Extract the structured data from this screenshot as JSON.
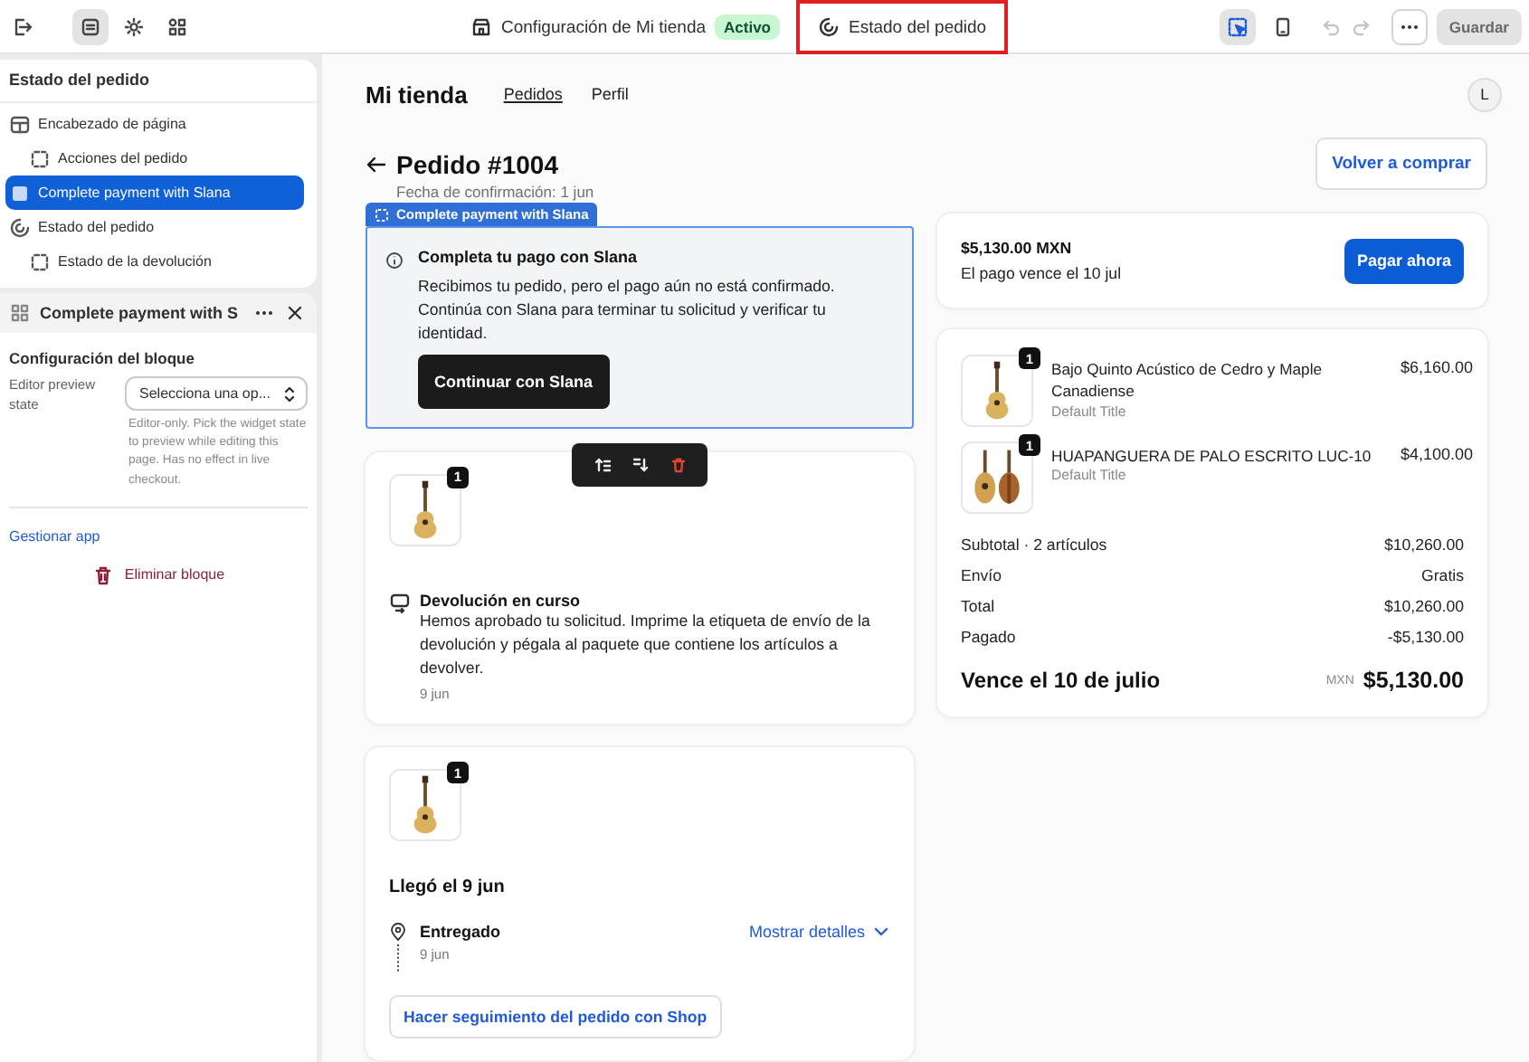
{
  "topbar": {
    "tools": [
      {
        "kind": "sections",
        "selected": true
      },
      {
        "kind": "settings",
        "selected": false
      },
      {
        "kind": "apps",
        "selected": false
      }
    ],
    "store_title": "Configuración de Mi tienda",
    "status_badge": "Activo",
    "page_selector": {
      "label": "Estado del pedido",
      "highlighted": true
    },
    "view_tools": [
      {
        "kind": "inspector",
        "selected": true
      },
      {
        "kind": "mobile",
        "selected": false
      }
    ],
    "history_disabled": true,
    "save_button": {
      "label": "Guardar",
      "disabled": true
    }
  },
  "sidebar": {
    "title": "Estado del pedido",
    "items": [
      {
        "label": "Encabezado de página",
        "kind": "section",
        "selected": false,
        "children": [
          {
            "label": "Acciones del pedido",
            "kind": "block",
            "selected": false
          }
        ]
      },
      {
        "label": "Complete payment with Slana",
        "kind": "app",
        "selected": true
      },
      {
        "label": "Estado del pedido",
        "kind": "status",
        "selected": false,
        "children": [
          {
            "label": "Estado de la devolución",
            "kind": "block",
            "selected": false
          }
        ]
      }
    ]
  },
  "block_panel": {
    "title": "Complete payment with S",
    "section_title": "Configuración del bloque",
    "field": {
      "label": "Editor preview state",
      "value": "Selecciona una op...",
      "help": "Editor-only. Pick the widget state to preview while editing this page. Has no effect in live checkout."
    },
    "manage_link": "Gestionar app",
    "delete_button": "Eliminar bloque"
  },
  "preview": {
    "store_name": "Mi tienda",
    "nav": [
      {
        "label": "Pedidos",
        "selected": true
      },
      {
        "label": "Perfil",
        "selected": false
      }
    ],
    "avatar": "L",
    "order_title": "Pedido #1004",
    "confirmation": "Fecha de confirmación: 1 jun",
    "reorder_button": "Volver a comprar",
    "block_tag": "Complete payment with Slana",
    "payment_block": {
      "title": "Completa tu pago con Slana",
      "body": "Recibimos tu pedido, pero el pago aún no está confirmado. Continúa con Slana para terminar tu solicitud y verificar tu identidad.",
      "button": "Continuar con Slana"
    },
    "return_card": {
      "quantity": "1",
      "title": "Devolución en curso",
      "body": "Hemos aprobado tu solicitud. Imprime la etiqueta de envío de la devolución y pégala al paquete que contiene los artículos a devolver.",
      "date": "9 jun"
    },
    "delivery_card": {
      "quantity": "1",
      "title": "Llegó el 9 jun",
      "status": "Entregado",
      "date": "9 jun",
      "details_link": "Mostrar detalles",
      "track_button": "Hacer seguimiento del pedido con Shop"
    },
    "payment_due": {
      "amount": "$5,130.00 MXN",
      "due": "El pago vence el 10 jul",
      "button": "Pagar ahora"
    },
    "summary": {
      "items": [
        {
          "name": "Bajo Quinto Acústico de Cedro y Maple Canadiense",
          "variant": "Default Title",
          "price": "$6,160.00",
          "quantity": "1",
          "kind": "single"
        },
        {
          "name": "HUAPANGUERA DE PALO ESCRITO LUC-10",
          "variant": "Default Title",
          "price": "$4,100.00",
          "quantity": "1",
          "kind": "double"
        }
      ],
      "rows": [
        {
          "label": "Subtotal · 2 artículos",
          "value": "$10,260.00"
        },
        {
          "label": "Envío",
          "value": "Gratis"
        },
        {
          "label": "Total",
          "value": "$10,260.00"
        },
        {
          "label": "Pagado",
          "value": "-$5,130.00"
        }
      ],
      "total": {
        "label": "Vence el 10 de julio",
        "currency": "MXN",
        "amount": "$5,130.00"
      }
    }
  }
}
